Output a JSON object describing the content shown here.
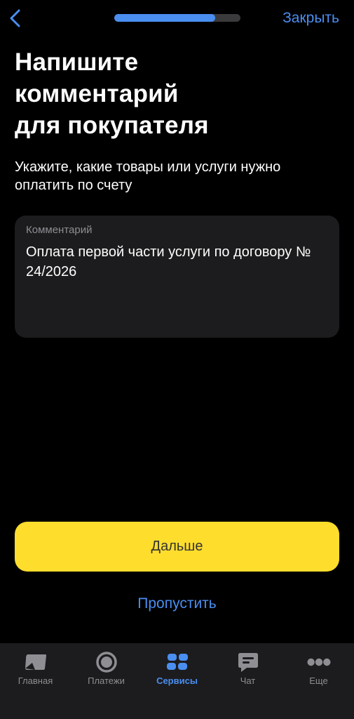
{
  "header": {
    "close_label": "Закрыть",
    "progress": 0.8
  },
  "title": {
    "line1": "Напишите",
    "line2": "комментарий",
    "line3": "для покупателя"
  },
  "subtitle": "Укажите, какие товары или услуги нужно оплатить по счету",
  "comment": {
    "label": "Комментарий",
    "value": "Оплата первой части услуги по договору № 24/2026"
  },
  "actions": {
    "next_label": "Дальше",
    "skip_label": "Пропустить"
  },
  "tabbar": {
    "items": [
      {
        "label": "Главная",
        "icon": "home-icon"
      },
      {
        "label": "Платежи",
        "icon": "payments-icon"
      },
      {
        "label": "Сервисы",
        "icon": "services-icon"
      },
      {
        "label": "Чат",
        "icon": "chat-icon"
      },
      {
        "label": "Еще",
        "icon": "more-icon"
      }
    ],
    "active_index": 2
  },
  "colors": {
    "accent": "#4a8ef0",
    "primary_button": "#ffdd2d",
    "background": "#000000",
    "surface": "#1c1c1e"
  }
}
